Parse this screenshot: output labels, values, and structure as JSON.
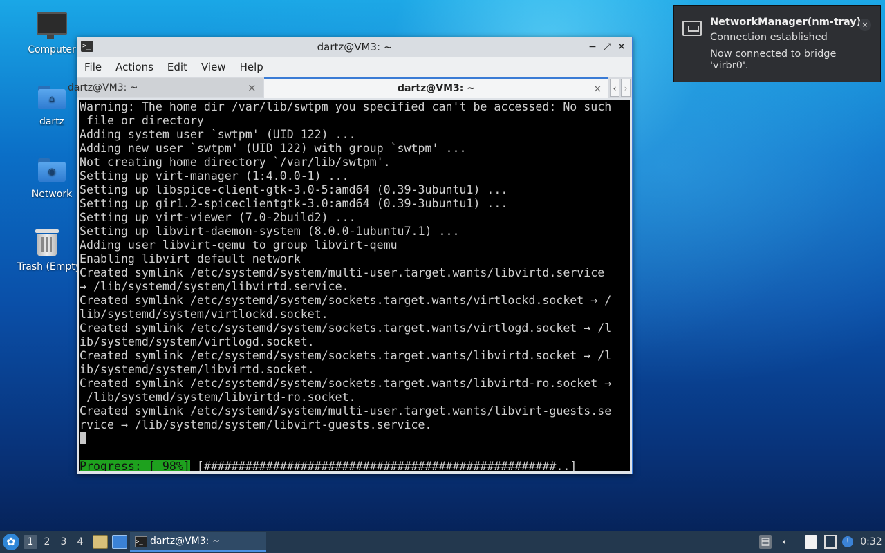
{
  "desktop": {
    "icons": [
      {
        "label": "Computer"
      },
      {
        "label": "dartz"
      },
      {
        "label": "Network"
      },
      {
        "label": "Trash (Empty)"
      }
    ]
  },
  "window": {
    "title": "dartz@VM3: ~",
    "menu": [
      "File",
      "Actions",
      "Edit",
      "View",
      "Help"
    ],
    "tabs": [
      {
        "label": "dartz@VM3: ~",
        "active": false
      },
      {
        "label": "dartz@VM3: ~",
        "active": true
      }
    ],
    "controls": {
      "minimize": "−",
      "maximize": "⤢",
      "close": "✕"
    }
  },
  "terminal": {
    "lines": [
      "Warning: The home dir /var/lib/swtpm you specified can't be accessed: No such",
      " file or directory",
      "Adding system user `swtpm' (UID 122) ...",
      "Adding new user `swtpm' (UID 122) with group `swtpm' ...",
      "Not creating home directory `/var/lib/swtpm'.",
      "Setting up virt-manager (1:4.0.0-1) ...",
      "Setting up libspice-client-gtk-3.0-5:amd64 (0.39-3ubuntu1) ...",
      "Setting up gir1.2-spiceclientgtk-3.0:amd64 (0.39-3ubuntu1) ...",
      "Setting up virt-viewer (7.0-2build2) ...",
      "Setting up libvirt-daemon-system (8.0.0-1ubuntu7.1) ...",
      "Adding user libvirt-qemu to group libvirt-qemu",
      "Enabling libvirt default network",
      "Created symlink /etc/systemd/system/multi-user.target.wants/libvirtd.service",
      "→ /lib/systemd/system/libvirtd.service.",
      "Created symlink /etc/systemd/system/sockets.target.wants/virtlockd.socket → /",
      "lib/systemd/system/virtlockd.socket.",
      "Created symlink /etc/systemd/system/sockets.target.wants/virtlogd.socket → /l",
      "ib/systemd/system/virtlogd.socket.",
      "Created symlink /etc/systemd/system/sockets.target.wants/libvirtd.socket → /l",
      "ib/systemd/system/libvirtd.socket.",
      "Created symlink /etc/systemd/system/sockets.target.wants/libvirtd-ro.socket →",
      " /lib/systemd/system/libvirtd-ro.socket.",
      "Created symlink /etc/systemd/system/multi-user.target.wants/libvirt-guests.se",
      "rvice → /lib/systemd/system/libvirt-guests.service."
    ],
    "progress_label": "Progress: [ 98%]",
    "progress_bar": " [###################################################..]"
  },
  "notification": {
    "title": "NetworkManager(nm-tray)",
    "summary": "Connection established",
    "message": "Now connected to bridge 'virbr0'.",
    "close": "×"
  },
  "taskbar": {
    "workspaces": [
      "1",
      "2",
      "3",
      "4"
    ],
    "task_label": "dartz@VM3: ~",
    "clock": "0:32"
  }
}
